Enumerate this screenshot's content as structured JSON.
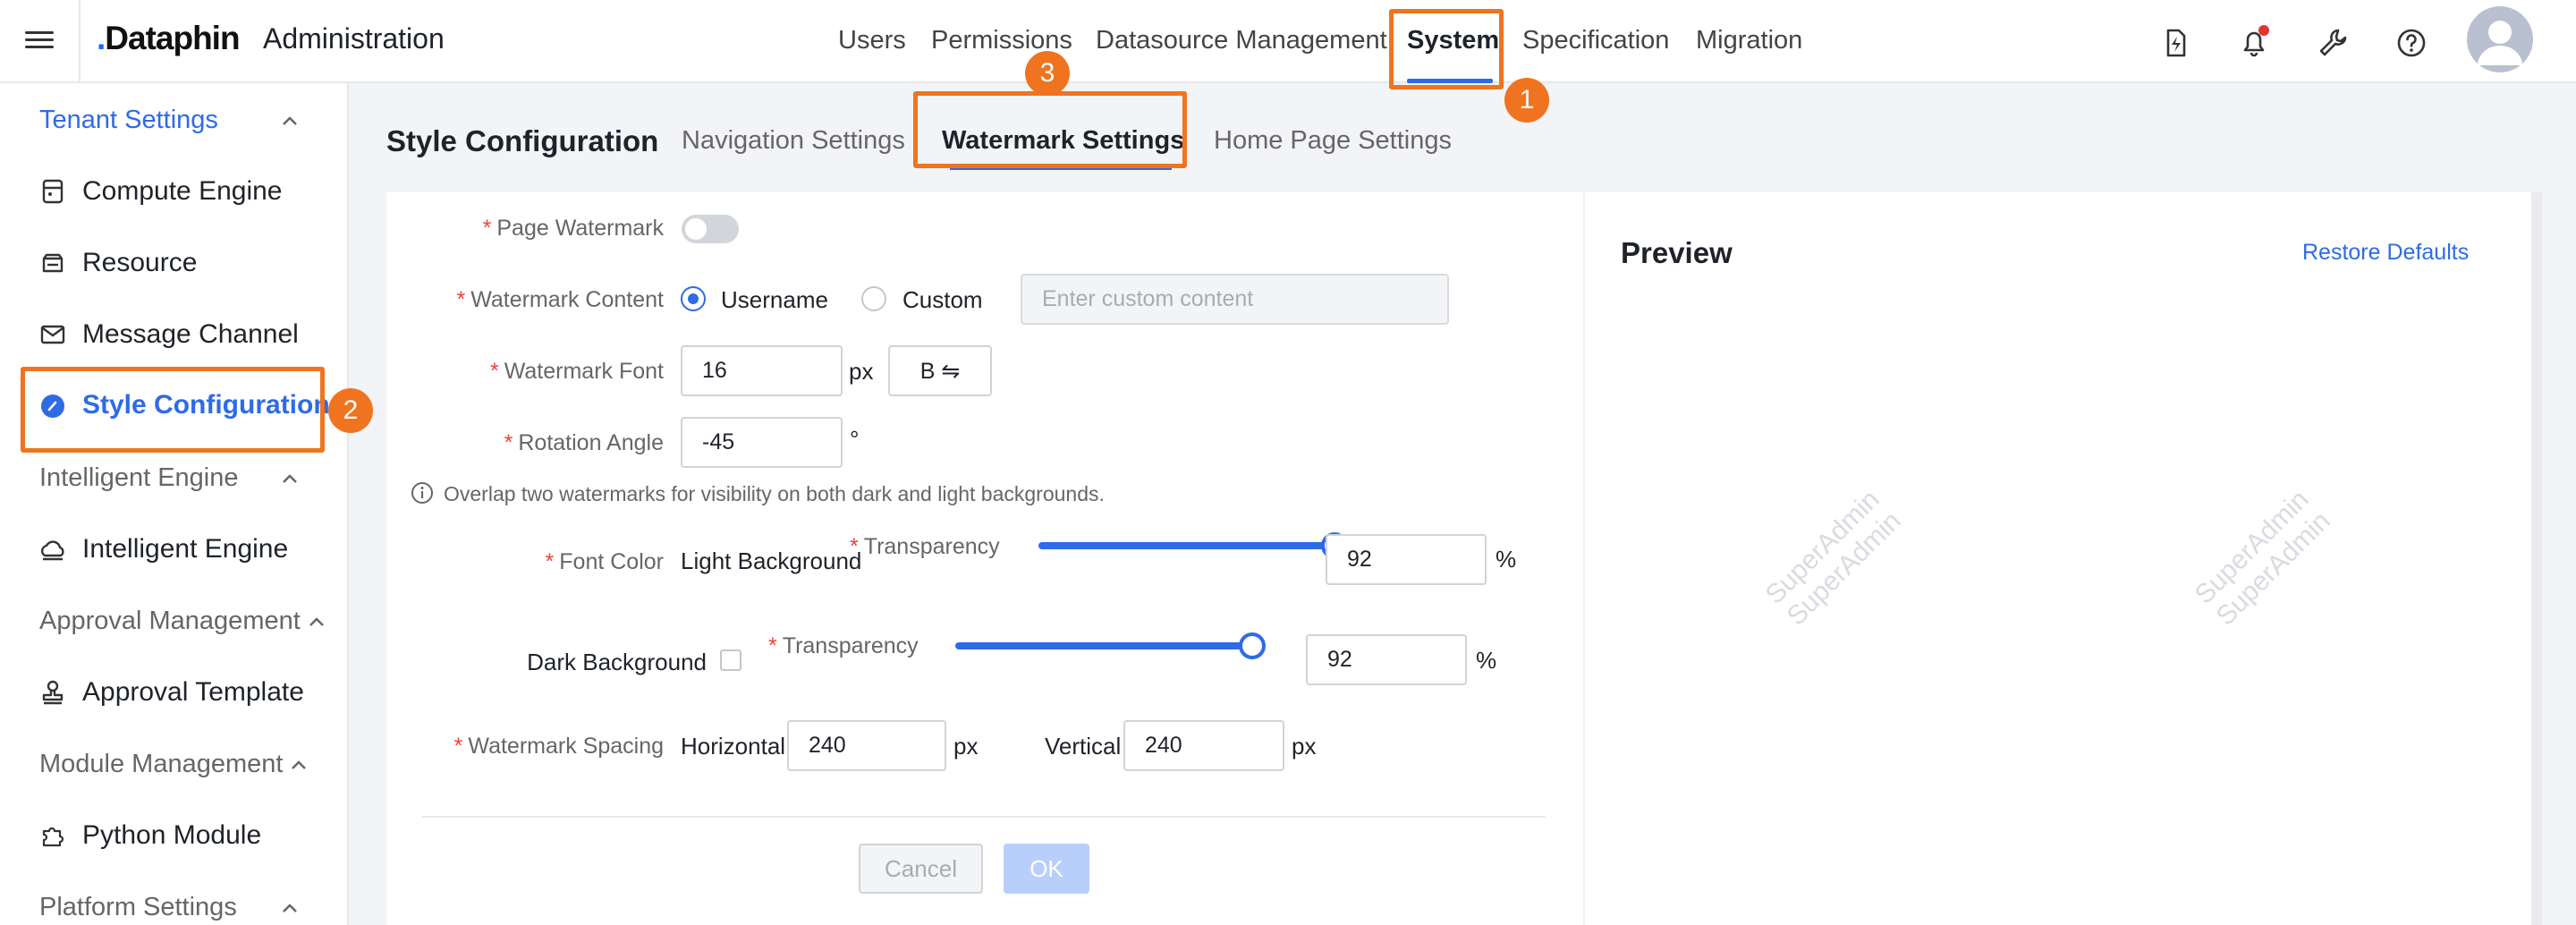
{
  "header": {
    "logo_text": "Dataphin",
    "app_title": "Administration",
    "nav": [
      "Users",
      "Permissions",
      "Datasource Management",
      "System",
      "Specification",
      "Migration"
    ],
    "active_nav": "System",
    "icons": [
      "lightning-tag-icon",
      "bell-icon",
      "wrench-icon",
      "help-icon",
      "avatar"
    ]
  },
  "sidebar": {
    "tenant_settings": "Tenant Settings",
    "compute_engine": "Compute Engine",
    "resource": "Resource",
    "message_channel": "Message Channel",
    "style_configuration": "Style Configuration",
    "intelligent_engine_group": "Intelligent Engine",
    "intelligent_engine": "Intelligent Engine",
    "approval_management": "Approval Management",
    "approval_template": "Approval Template",
    "module_management": "Module Management",
    "python_module": "Python Module",
    "platform_settings": "Platform Settings"
  },
  "page": {
    "title": "Style Configuration",
    "tabs": [
      "Navigation Settings",
      "Watermark Settings",
      "Home Page Settings"
    ],
    "active_tab": "Watermark Settings"
  },
  "form": {
    "page_watermark_label": "Page Watermark",
    "page_watermark_on": false,
    "watermark_content_label": "Watermark Content",
    "opt_username": "Username",
    "opt_custom": "Custom",
    "custom_placeholder": "Enter custom content",
    "watermark_font_label": "Watermark Font",
    "font_size": "16",
    "unit_px": "px",
    "font_style_btn": "B ⇋",
    "rotation_label": "Rotation Angle",
    "rotation_value": "-45",
    "unit_deg": "°",
    "info_note": "Overlap two watermarks for visibility on both dark and light backgrounds.",
    "font_color_label": "Font Color",
    "light_bg": "Light Background",
    "transparency_label": "Transparency",
    "light_transparency": "92",
    "dark_bg": "Dark Background",
    "dark_transparency": "92",
    "percent": "%",
    "spacing_label": "Watermark Spacing",
    "horizontal": "Horizontal",
    "horizontal_value": "240",
    "vertical": "Vertical",
    "vertical_value": "240",
    "cancel": "Cancel",
    "ok": "OK"
  },
  "preview": {
    "title": "Preview",
    "restore": "Restore Defaults",
    "watermark_text": "SuperAdmin"
  },
  "annotations": [
    "1",
    "2",
    "3"
  ],
  "colors": {
    "accent": "#2e6be6",
    "highlight": "#f0741f",
    "required": "#f04134"
  }
}
